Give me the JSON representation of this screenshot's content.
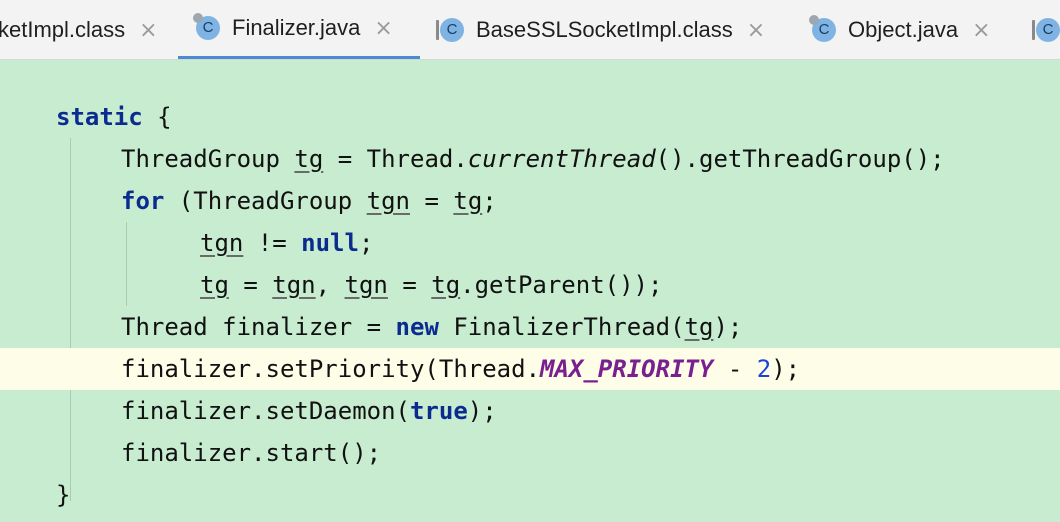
{
  "tabs": [
    {
      "label": "ketImpl.class",
      "icon": "class-icon",
      "active": false
    },
    {
      "label": "Finalizer.java",
      "icon": "java-class-icon",
      "active": true
    },
    {
      "label": "BaseSSLSocketImpl.class",
      "icon": "class-icon",
      "active": false
    },
    {
      "label": "Object.java",
      "icon": "java-class-icon",
      "active": false
    },
    {
      "label": "",
      "icon": "class-icon",
      "active": false
    }
  ],
  "tab_close_glyph": "×",
  "class_icon_letter": "C",
  "colors": {
    "editor_bg": "#c7ecd0",
    "current_line_bg": "#fdfde8",
    "keyword": "#0b2b8f",
    "constant": "#7a1f8e",
    "number": "#1a44d6",
    "active_tab_underline": "#4a8bd1"
  },
  "code": {
    "l1": {
      "kw": "static",
      "rest": " {"
    },
    "l2": {
      "a": "ThreadGroup ",
      "v1": "tg",
      "b": " = Thread.",
      "m": "currentThread",
      "c": "().getThreadGroup();"
    },
    "l3": {
      "kw": "for",
      "a": " (ThreadGroup ",
      "v1": "tgn",
      "b": " = ",
      "v2": "tg",
      "c": ";"
    },
    "l4": {
      "v1": "tgn",
      "a": " != ",
      "kw": "null",
      "b": ";"
    },
    "l5": {
      "v1": "tg",
      "a": " = ",
      "v2": "tgn",
      "b": ", ",
      "v3": "tgn",
      "c": " = ",
      "v4": "tg",
      "d": ".getParent());"
    },
    "l6": {
      "a": "Thread finalizer = ",
      "kw": "new",
      "b": " FinalizerThread(",
      "v1": "tg",
      "c": ");"
    },
    "l7": {
      "a": "finalizer.setPriority(Thread.",
      "const": "MAX_PRIORITY",
      "b": " - ",
      "num": "2",
      "c": ");"
    },
    "l8": {
      "a": "finalizer.setDaemon(",
      "kw": "true",
      "b": ");"
    },
    "l9": {
      "a": "finalizer.start();"
    },
    "l10": {
      "a": "}"
    }
  }
}
